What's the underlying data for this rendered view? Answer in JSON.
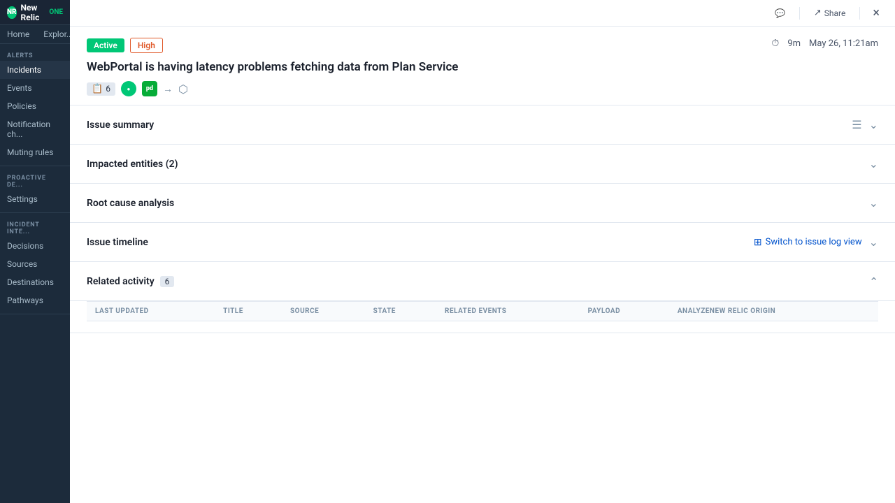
{
  "app": {
    "name": "New Relic",
    "logo_icon": "NR"
  },
  "sidebar": {
    "top_nav": [
      {
        "label": "Home",
        "id": "home"
      },
      {
        "label": "Explor...",
        "id": "explorer"
      }
    ],
    "sections": [
      {
        "label": "ALERTS",
        "items": [
          {
            "label": "Incidents",
            "id": "incidents",
            "active": true
          },
          {
            "label": "Events",
            "id": "events"
          },
          {
            "label": "Policies",
            "id": "policies"
          },
          {
            "label": "Notification ch...",
            "id": "notification-channels"
          },
          {
            "label": "Muting rules",
            "id": "muting-rules"
          }
        ]
      },
      {
        "label": "PROACTIVE DE...",
        "items": [
          {
            "label": "Settings",
            "id": "settings"
          }
        ]
      },
      {
        "label": "INCIDENT INTE...",
        "items": [
          {
            "label": "Decisions",
            "id": "decisions"
          },
          {
            "label": "Sources",
            "id": "sources"
          },
          {
            "label": "Destinations",
            "id": "destinations"
          },
          {
            "label": "Pathways",
            "id": "pathways"
          }
        ]
      }
    ]
  },
  "issue_panel": {
    "topbar": {
      "comment_icon": "💬",
      "share_label": "Share",
      "close_icon": "×"
    },
    "status_badges": {
      "active": "Active",
      "severity": "High"
    },
    "time_info": {
      "duration": "9m",
      "datetime": "May 26, 11:21am"
    },
    "title": "WebPortal is having latency problems fetching data from Plan Service",
    "meta": {
      "count": "6",
      "integration_nr_label": "NR",
      "integration_pd_label": "pd",
      "arrow": "→",
      "workflow_icon": "⬡"
    },
    "sections": [
      {
        "id": "issue-summary",
        "title": "Issue summary",
        "has_format_icon": true,
        "collapsed": true
      },
      {
        "id": "impacted-entities",
        "title": "Impacted entities (2)",
        "collapsed": true
      },
      {
        "id": "root-cause",
        "title": "Root cause analysis",
        "collapsed": true
      },
      {
        "id": "issue-timeline",
        "title": "Issue timeline",
        "has_switch_log": true,
        "switch_log_label": "Switch to issue log view",
        "collapsed": true
      }
    ],
    "related_activity": {
      "title": "Related activity",
      "count": "6",
      "is_expanded": true,
      "table_headers": [
        "LAST UPDATED",
        "TITLE",
        "SOURCE",
        "STATE",
        "RELATED EVENTS",
        "PAYLOAD",
        "ANALYZENEW RELIC ORIGIN"
      ]
    }
  }
}
